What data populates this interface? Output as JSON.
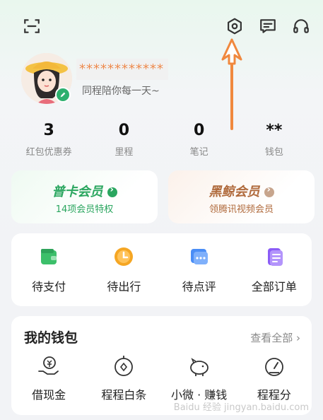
{
  "header": {
    "icons": [
      "scan-icon",
      "settings-icon",
      "message-icon",
      "headset-icon"
    ]
  },
  "profile": {
    "nickname": "************",
    "motto": "同程陪你每一天~"
  },
  "stats": [
    {
      "value": "3",
      "label": "红包优惠券"
    },
    {
      "value": "0",
      "label": "里程"
    },
    {
      "value": "0",
      "label": "笔记"
    },
    {
      "value": "**",
      "label": "钱包"
    }
  ],
  "membership": {
    "left": {
      "title": "普卡会员",
      "subtitle": "14项会员特权",
      "color": "#2aa65f"
    },
    "right": {
      "title": "黑鲸会员",
      "subtitle": "领腾讯视频会员",
      "color": "#b06a3c"
    }
  },
  "orders": [
    {
      "label": "待支付",
      "icon": "wallet-green-icon"
    },
    {
      "label": "待出行",
      "icon": "clock-orange-icon"
    },
    {
      "label": "待点评",
      "icon": "comment-blue-icon"
    },
    {
      "label": "全部订单",
      "icon": "list-purple-icon"
    }
  ],
  "wallet": {
    "title": "我的钱包",
    "more": "查看全部",
    "items": [
      {
        "label": "借现金",
        "icon": "cash-hand-icon"
      },
      {
        "label": "程程白条",
        "icon": "coin-icon"
      },
      {
        "label": "小微 · 赚钱",
        "icon": "piggy-bank-icon"
      },
      {
        "label": "程程分",
        "icon": "gauge-icon"
      }
    ]
  },
  "watermark": "Baidu 经验 jingyan.baidu.com",
  "colors": {
    "accent_green": "#2aa65f",
    "annotation_arrow": "#f0883e"
  }
}
